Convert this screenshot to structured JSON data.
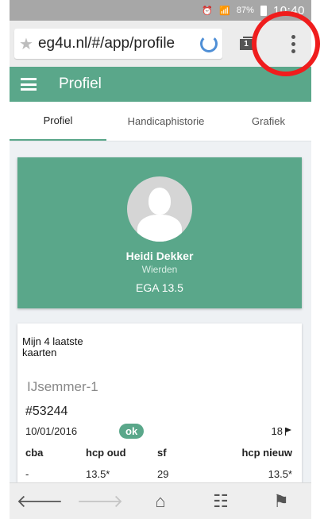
{
  "status_bar": {
    "battery": "87%",
    "time": "10:40"
  },
  "browser": {
    "url": "eg4u.nl/#/app/profile",
    "tab_count": "1"
  },
  "app_bar": {
    "title": "Profiel"
  },
  "tabs": [
    {
      "label": "Profiel"
    },
    {
      "label": "Handicaphistorie"
    },
    {
      "label": "Grafiek"
    }
  ],
  "profile": {
    "name": "Heidi Dekker",
    "city": "Wierden",
    "ega": "EGA 13.5"
  },
  "cards": {
    "heading": "Mijn 4 laatste kaarten",
    "course": "IJsemmer-1",
    "card_number": "#53244",
    "date": "10/01/2016",
    "status": "ok",
    "holes": "18",
    "headers": [
      "cba",
      "hcp oud",
      "sf",
      "hcp nieuw"
    ],
    "row": [
      "-",
      "13.5*",
      "29",
      "13.5*"
    ]
  },
  "colors": {
    "accent": "#5aa78a",
    "annotation": "#ef1d1d"
  }
}
